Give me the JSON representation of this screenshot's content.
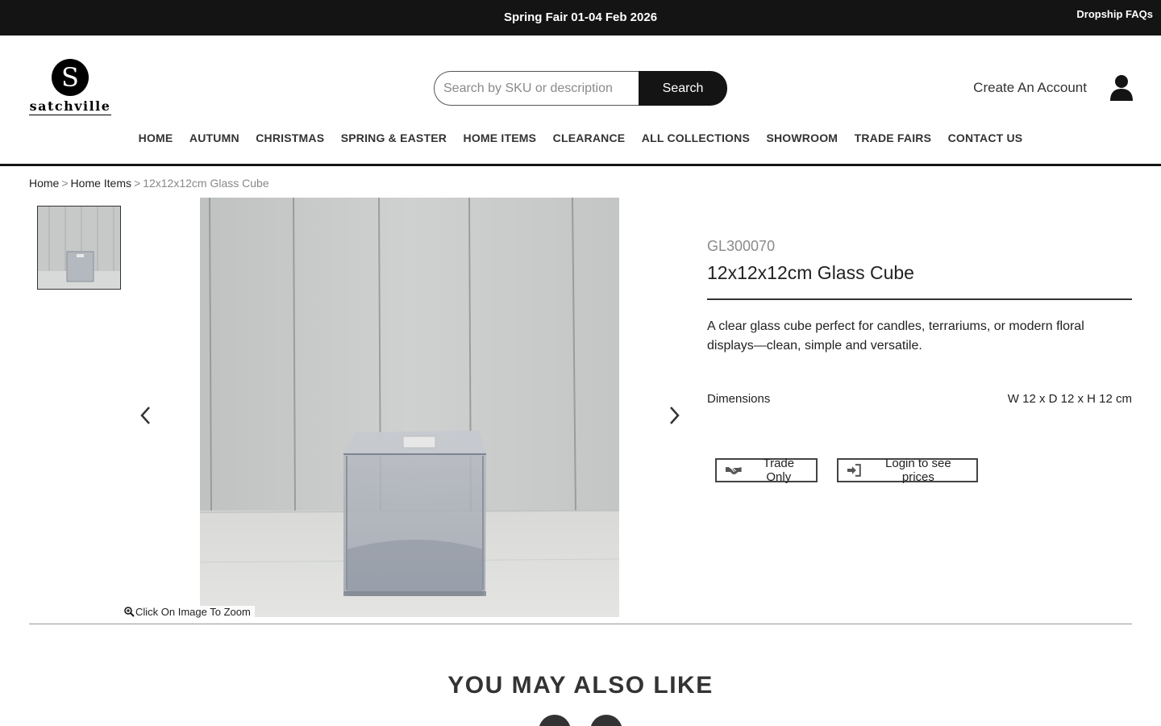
{
  "announcement": {
    "promo_text": "Spring Fair 01-04 Feb 2026",
    "faq_link": "Dropship FAQs"
  },
  "header": {
    "logo_letter": "S",
    "logo_text": "satchville",
    "search": {
      "placeholder": "Search by SKU or description",
      "value": "",
      "button_label": "Search"
    },
    "account_link": "Create An Account",
    "user_icon": "user-icon"
  },
  "nav": {
    "items": [
      {
        "label": "HOME"
      },
      {
        "label": "AUTUMN"
      },
      {
        "label": "CHRISTMAS"
      },
      {
        "label": "SPRING & EASTER"
      },
      {
        "label": "HOME ITEMS"
      },
      {
        "label": "CLEARANCE"
      },
      {
        "label": "ALL COLLECTIONS"
      },
      {
        "label": "SHOWROOM"
      },
      {
        "label": "TRADE FAIRS"
      },
      {
        "label": "CONTACT US"
      }
    ]
  },
  "breadcrumb": {
    "items": [
      {
        "label": "Home"
      },
      {
        "label": "Home Items"
      },
      {
        "label": "12x12x12cm Glass Cube"
      }
    ],
    "separator": ">"
  },
  "gallery": {
    "zoom_hint": "Click On Image To Zoom",
    "prev_icon": "chevron-left-icon",
    "next_icon": "chevron-right-icon"
  },
  "product": {
    "sku": "GL300070",
    "title": "12x12x12cm Glass Cube",
    "description": "A clear glass cube perfect for candles, terrariums, or modern floral displays—clean, simple and versatile.",
    "dimensions_label": "Dimensions",
    "dimensions_value": "W 12 x D 12 x H 12 cm",
    "trade_only_label": "Trade Only",
    "login_label": "Login to see prices"
  },
  "related": {
    "heading": "YOU MAY ALSO LIKE"
  },
  "colors": {
    "topbar": "#141414",
    "accent": "#141414",
    "muted_text": "#8a8a8a"
  }
}
